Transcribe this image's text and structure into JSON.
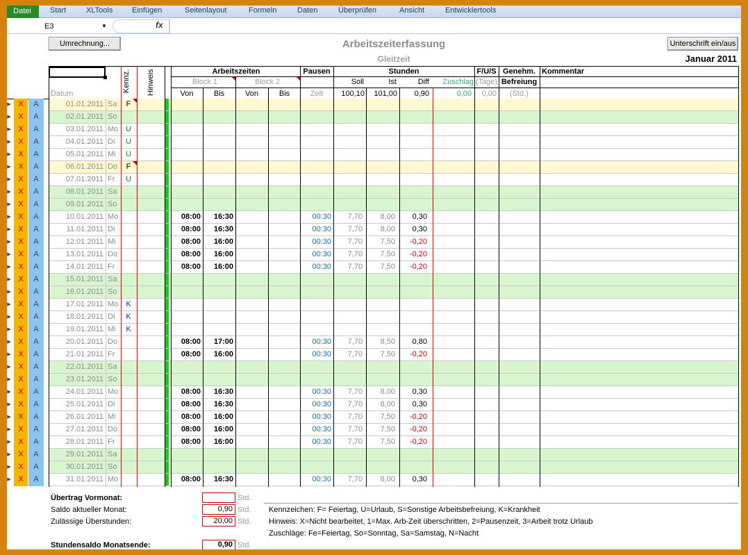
{
  "ribbon": {
    "file": "Datei",
    "tabs": [
      "Start",
      "XLTools",
      "Einfügen",
      "Seitenlayout",
      "Formeln",
      "Daten",
      "Überprüfen",
      "Ansicht",
      "Entwicklertools"
    ]
  },
  "formula_bar": {
    "cell_ref": "E3",
    "fx": "fx"
  },
  "buttons": {
    "convert": "Umrechnung...",
    "signature": "Unterschrift ein/aus"
  },
  "sheet": {
    "title": "Arbeitszeiterfassung",
    "subtitle": "Gleitzeit",
    "month": "Januar 2011"
  },
  "headers": {
    "datum": "Datum",
    "kennz": "Kennz.",
    "hinweis": "Hinweis",
    "arbeitszeiten": "Arbeitszeiten",
    "block1": "Block 1",
    "block2": "Block 2",
    "von1": "Von",
    "bis1": "Bis",
    "von2": "Von",
    "bis2": "Bis",
    "pausen": "Pausen",
    "zeit": "Zeit",
    "stunden": "Stunden",
    "soll": "Soll",
    "ist": "Ist",
    "diff": "Diff",
    "zuschlag": "Zuschlag",
    "fus": "F/U/S",
    "tage": "(Tage)",
    "genehm": "Genehm.",
    "befreiung": "Befreiung",
    "std": "(Std.)",
    "kommentar": "Kommentar"
  },
  "totals": {
    "soll": "100,10",
    "ist": "101,00",
    "diff": "0,90",
    "zuschlag": "0,00",
    "tage": "0,00"
  },
  "row_buttons": {
    "x": "X",
    "a": "A",
    "arrow": "▸"
  },
  "colors": {
    "weekend": "#d8f5d0",
    "holiday": "#fff8d0",
    "green_bar": "#1fc41f",
    "neg": "#c00000",
    "pause": "#1a6b9a",
    "orange": "#f4b400",
    "blue_btn": "#8ec3ee"
  },
  "rows": [
    {
      "date": "01.01.2011",
      "day": "Sa",
      "kennz": "F",
      "von": "",
      "bis": "",
      "pause": "",
      "soll": "",
      "ist": "",
      "diff": "",
      "type": "holiday"
    },
    {
      "date": "02.01.2011",
      "day": "So",
      "kennz": "",
      "von": "",
      "bis": "",
      "pause": "",
      "soll": "",
      "ist": "",
      "diff": "",
      "type": "weekend"
    },
    {
      "date": "03.01.2011",
      "day": "Mo",
      "kennz": "U",
      "von": "",
      "bis": "",
      "pause": "",
      "soll": "",
      "ist": "",
      "diff": "",
      "type": "work"
    },
    {
      "date": "04.01.2011",
      "day": "Di",
      "kennz": "U",
      "von": "",
      "bis": "",
      "pause": "",
      "soll": "",
      "ist": "",
      "diff": "",
      "type": "work"
    },
    {
      "date": "05.01.2011",
      "day": "Mi",
      "kennz": "U",
      "von": "",
      "bis": "",
      "pause": "",
      "soll": "",
      "ist": "",
      "diff": "",
      "type": "work"
    },
    {
      "date": "06.01.2011",
      "day": "Do",
      "kennz": "F",
      "von": "",
      "bis": "",
      "pause": "",
      "soll": "",
      "ist": "",
      "diff": "",
      "type": "holiday"
    },
    {
      "date": "07.01.2011",
      "day": "Fr",
      "kennz": "U",
      "von": "",
      "bis": "",
      "pause": "",
      "soll": "",
      "ist": "",
      "diff": "",
      "type": "work"
    },
    {
      "date": "08.01.2011",
      "day": "Sa",
      "kennz": "",
      "von": "",
      "bis": "",
      "pause": "",
      "soll": "",
      "ist": "",
      "diff": "",
      "type": "weekend"
    },
    {
      "date": "09.01.2011",
      "day": "So",
      "kennz": "",
      "von": "",
      "bis": "",
      "pause": "",
      "soll": "",
      "ist": "",
      "diff": "",
      "type": "weekend"
    },
    {
      "date": "10.01.2011",
      "day": "Mo",
      "kennz": "",
      "von": "08:00",
      "bis": "16:30",
      "pause": "00:30",
      "soll": "7,70",
      "ist": "8,00",
      "diff": "0,30",
      "type": "work"
    },
    {
      "date": "11.01.2011",
      "day": "Di",
      "kennz": "",
      "von": "08:00",
      "bis": "16:30",
      "pause": "00:30",
      "soll": "7,70",
      "ist": "8,00",
      "diff": "0,30",
      "type": "work"
    },
    {
      "date": "12.01.2011",
      "day": "Mi",
      "kennz": "",
      "von": "08:00",
      "bis": "16:00",
      "pause": "00:30",
      "soll": "7,70",
      "ist": "7,50",
      "diff": "-0,20",
      "type": "work"
    },
    {
      "date": "13.01.2011",
      "day": "Do",
      "kennz": "",
      "von": "08:00",
      "bis": "16:00",
      "pause": "00:30",
      "soll": "7,70",
      "ist": "7,50",
      "diff": "-0,20",
      "type": "work"
    },
    {
      "date": "14.01.2011",
      "day": "Fr",
      "kennz": "",
      "von": "08:00",
      "bis": "16:00",
      "pause": "00:30",
      "soll": "7,70",
      "ist": "7,50",
      "diff": "-0,20",
      "type": "work"
    },
    {
      "date": "15.01.2011",
      "day": "Sa",
      "kennz": "",
      "von": "",
      "bis": "",
      "pause": "",
      "soll": "",
      "ist": "",
      "diff": "",
      "type": "weekend"
    },
    {
      "date": "16.01.2011",
      "day": "So",
      "kennz": "",
      "von": "",
      "bis": "",
      "pause": "",
      "soll": "",
      "ist": "",
      "diff": "",
      "type": "weekend"
    },
    {
      "date": "17.01.2011",
      "day": "Mo",
      "kennz": "K",
      "von": "",
      "bis": "",
      "pause": "",
      "soll": "",
      "ist": "",
      "diff": "",
      "type": "work"
    },
    {
      "date": "18.01.2011",
      "day": "Di",
      "kennz": "K",
      "von": "",
      "bis": "",
      "pause": "",
      "soll": "",
      "ist": "",
      "diff": "",
      "type": "work"
    },
    {
      "date": "19.01.2011",
      "day": "Mi",
      "kennz": "K",
      "von": "",
      "bis": "",
      "pause": "",
      "soll": "",
      "ist": "",
      "diff": "",
      "type": "work"
    },
    {
      "date": "20.01.2011",
      "day": "Do",
      "kennz": "",
      "von": "08:00",
      "bis": "17:00",
      "pause": "00:30",
      "soll": "7,70",
      "ist": "8,50",
      "diff": "0,80",
      "type": "work"
    },
    {
      "date": "21.01.2011",
      "day": "Fr",
      "kennz": "",
      "von": "08:00",
      "bis": "16:00",
      "pause": "00:30",
      "soll": "7,70",
      "ist": "7,50",
      "diff": "-0,20",
      "type": "work"
    },
    {
      "date": "22.01.2011",
      "day": "Sa",
      "kennz": "",
      "von": "",
      "bis": "",
      "pause": "",
      "soll": "",
      "ist": "",
      "diff": "",
      "type": "weekend"
    },
    {
      "date": "23.01.2011",
      "day": "So",
      "kennz": "",
      "von": "",
      "bis": "",
      "pause": "",
      "soll": "",
      "ist": "",
      "diff": "",
      "type": "weekend"
    },
    {
      "date": "24.01.2011",
      "day": "Mo",
      "kennz": "",
      "von": "08:00",
      "bis": "16:30",
      "pause": "00:30",
      "soll": "7,70",
      "ist": "8,00",
      "diff": "0,30",
      "type": "work"
    },
    {
      "date": "25.01.2011",
      "day": "Di",
      "kennz": "",
      "von": "08:00",
      "bis": "16:30",
      "pause": "00:30",
      "soll": "7,70",
      "ist": "8,00",
      "diff": "0,30",
      "type": "work"
    },
    {
      "date": "26.01.2011",
      "day": "Mi",
      "kennz": "",
      "von": "08:00",
      "bis": "16:00",
      "pause": "00:30",
      "soll": "7,70",
      "ist": "7,50",
      "diff": "-0,20",
      "type": "work"
    },
    {
      "date": "27.01.2011",
      "day": "Do",
      "kennz": "",
      "von": "08:00",
      "bis": "16:00",
      "pause": "00:30",
      "soll": "7,70",
      "ist": "7,50",
      "diff": "-0,20",
      "type": "work"
    },
    {
      "date": "28.01.2011",
      "day": "Fr",
      "kennz": "",
      "von": "08:00",
      "bis": "16:00",
      "pause": "00:30",
      "soll": "7,70",
      "ist": "7,50",
      "diff": "-0,20",
      "type": "work"
    },
    {
      "date": "29.01.2011",
      "day": "Sa",
      "kennz": "",
      "von": "",
      "bis": "",
      "pause": "",
      "soll": "",
      "ist": "",
      "diff": "",
      "type": "weekend"
    },
    {
      "date": "30.01.2011",
      "day": "So",
      "kennz": "",
      "von": "",
      "bis": "",
      "pause": "",
      "soll": "",
      "ist": "",
      "diff": "",
      "type": "weekend"
    },
    {
      "date": "31.01.2011",
      "day": "Mo",
      "kennz": "",
      "von": "08:00",
      "bis": "16:30",
      "pause": "00:30",
      "soll": "7,70",
      "ist": "8,00",
      "diff": "0,30",
      "type": "work"
    }
  ],
  "footer": {
    "uebertrag_label": "Übertrag Vormonat:",
    "uebertrag_value": "",
    "unit": "Std.",
    "saldo_label": "Saldo aktueller Monat:",
    "saldo_value": "0,90",
    "zulaessig_label": "Zulässige Überstunden:",
    "zulaessig_value": "20,00",
    "monatsende_label": "Stundensaldo Monatsende:",
    "monatsende_value": "0,90",
    "legend_kennzeichen": "Kennzeichen: F= Feiertag, U=Urlaub, S=Sonstige Arbeitsbefreiung, K=Krankheit",
    "legend_hinweis": "Hinweis: X=Nicht bearbeitet, 1=Max. Arb-Zeit überschritten, 2=Pausenzeit, 3=Arbeit trotz Urlaub",
    "legend_zuschlaege": "Zuschläge: Fe=Feiertag, So=Sonntag, Sa=Samstag, N=Nacht"
  }
}
